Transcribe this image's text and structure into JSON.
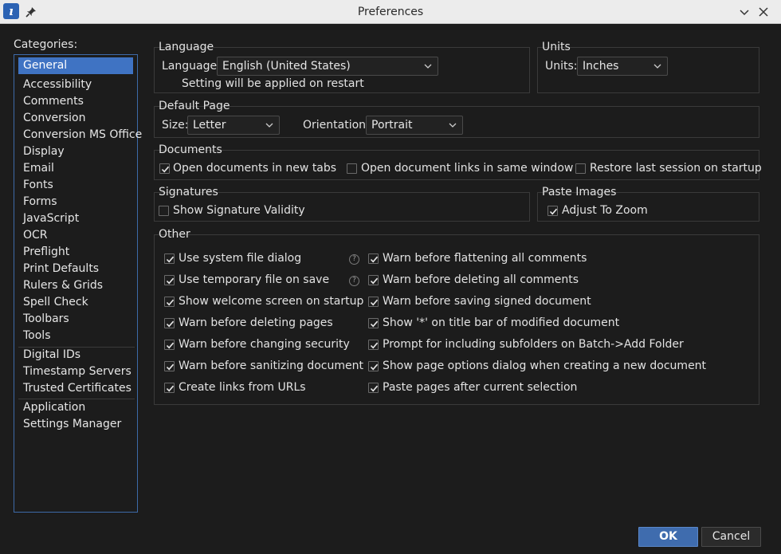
{
  "window": {
    "title": "Preferences",
    "app_icon_glyph": "ı"
  },
  "categories": {
    "label": "Categories:",
    "items": [
      "General",
      "Accessibility",
      "Comments",
      "Conversion",
      "Conversion MS Office",
      "Display",
      "Email",
      "Fonts",
      "Forms",
      "JavaScript",
      "OCR",
      "Preflight",
      "Print Defaults",
      "Rulers & Grids",
      "Spell Check",
      "Toolbars",
      "Tools",
      "Digital IDs",
      "Timestamp Servers",
      "Trusted Certificates",
      "Application",
      "Settings Manager"
    ],
    "selected": "General"
  },
  "language": {
    "group_title": "Language",
    "label": "Language:",
    "value": "English (United States)",
    "note": "Setting will be applied on restart"
  },
  "units": {
    "group_title": "Units",
    "label": "Units:",
    "value": "Inches"
  },
  "default_page": {
    "group_title": "Default Page",
    "size_label": "Size:",
    "size_value": "Letter",
    "orientation_label": "Orientation:",
    "orientation_value": "Portrait"
  },
  "documents": {
    "group_title": "Documents",
    "options": [
      {
        "label": "Open documents in new tabs",
        "checked": true
      },
      {
        "label": "Open document links in same window",
        "checked": false
      },
      {
        "label": "Restore last session on startup",
        "checked": false
      }
    ]
  },
  "signatures": {
    "group_title": "Signatures",
    "options": [
      {
        "label": "Show Signature Validity",
        "checked": false
      }
    ]
  },
  "paste_images": {
    "group_title": "Paste Images",
    "options": [
      {
        "label": "Adjust To Zoom",
        "checked": true
      }
    ]
  },
  "other": {
    "group_title": "Other",
    "left": [
      {
        "label": "Use system file dialog",
        "checked": true,
        "help": true
      },
      {
        "label": "Use temporary file on save",
        "checked": true,
        "help": true
      },
      {
        "label": "Show welcome screen on startup",
        "checked": true
      },
      {
        "label": "Warn before deleting pages",
        "checked": true
      },
      {
        "label": "Warn before changing security",
        "checked": true
      },
      {
        "label": "Warn before sanitizing document",
        "checked": true
      },
      {
        "label": "Create links from URLs",
        "checked": true
      }
    ],
    "right": [
      {
        "label": "Warn before flattening all comments",
        "checked": true
      },
      {
        "label": "Warn before deleting all comments",
        "checked": true
      },
      {
        "label": "Warn before saving signed document",
        "checked": true
      },
      {
        "label": "Show '*' on title bar of modified document",
        "checked": true
      },
      {
        "label": "Prompt for including subfolders on Batch->Add Folder",
        "checked": true
      },
      {
        "label": "Show page options dialog when creating a new document",
        "checked": true
      },
      {
        "label": "Paste pages after current selection",
        "checked": true
      }
    ],
    "help_glyph": "?"
  },
  "buttons": {
    "ok": "OK",
    "cancel": "Cancel"
  },
  "colors": {
    "accent": "#3f73c3",
    "background": "#1c1c1c",
    "titlebar": "#ececec"
  }
}
